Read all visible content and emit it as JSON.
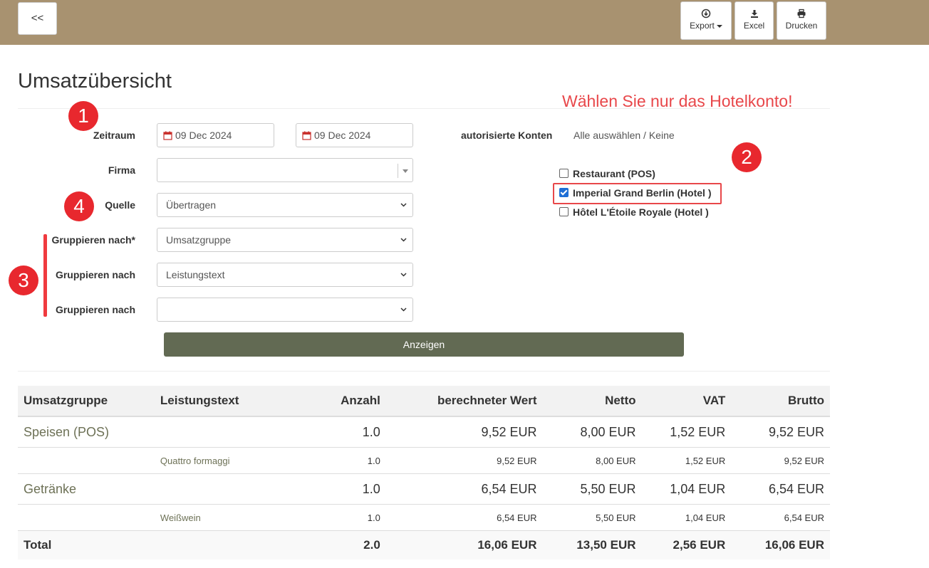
{
  "toolbar": {
    "back_label": "<<",
    "export_label": "Export",
    "excel_label": "Excel",
    "print_label": "Drucken"
  },
  "page": {
    "title": "Umsatzübersicht",
    "hint": "Wählen Sie nur das Hotelkonto!"
  },
  "badges": [
    "1",
    "2",
    "3",
    "4"
  ],
  "form": {
    "zeitraum_label": "Zeitraum",
    "date_from": "09 Dec 2024",
    "date_to": "09 Dec 2024",
    "firma_label": "Firma",
    "firma_value": "",
    "quelle_label": "Quelle",
    "quelle_value": "Übertragen",
    "group1_label": "Gruppieren nach*",
    "group1_value": "Umsatzgruppe",
    "group2_label": "Gruppieren nach",
    "group2_value": "Leistungstext",
    "group3_label": "Gruppieren nach",
    "group3_value": "",
    "submit_label": "Anzeigen"
  },
  "accounts": {
    "label": "autorisierte Konten",
    "select_all": "Alle auswählen",
    "separator": " / ",
    "select_none": "Keine",
    "items": [
      {
        "label": "Restaurant (POS)",
        "checked": false
      },
      {
        "label": "Imperial Grand Berlin (Hotel )",
        "checked": true
      },
      {
        "label": "Hôtel L'Étoile Royale (Hotel )",
        "checked": false
      }
    ]
  },
  "table": {
    "headers": [
      "Umsatzgruppe",
      "Leistungstext",
      "Anzahl",
      "berechneter Wert",
      "Netto",
      "VAT",
      "Brutto"
    ],
    "rows": [
      {
        "type": "group",
        "cells": [
          "Speisen (POS)",
          "",
          "1.0",
          "9,52 EUR",
          "8,00 EUR",
          "1,52 EUR",
          "9,52 EUR"
        ]
      },
      {
        "type": "detail",
        "cells": [
          "",
          "Quattro formaggi",
          "1.0",
          "9,52 EUR",
          "8,00 EUR",
          "1,52 EUR",
          "9,52 EUR"
        ]
      },
      {
        "type": "group",
        "cells": [
          "Getränke",
          "",
          "1.0",
          "6,54 EUR",
          "5,50 EUR",
          "1,04 EUR",
          "6,54 EUR"
        ]
      },
      {
        "type": "detail",
        "cells": [
          "",
          "Weißwein",
          "1.0",
          "6,54 EUR",
          "5,50 EUR",
          "1,04 EUR",
          "6,54 EUR"
        ]
      },
      {
        "type": "total",
        "cells": [
          "Total",
          "",
          "2.0",
          "16,06 EUR",
          "13,50 EUR",
          "2,56 EUR",
          "16,06 EUR"
        ]
      }
    ]
  },
  "colors": {
    "topbar": "#a89270",
    "accent_button": "#626a53",
    "annotation_red": "#e8282e",
    "link_text": "#6d7156"
  }
}
